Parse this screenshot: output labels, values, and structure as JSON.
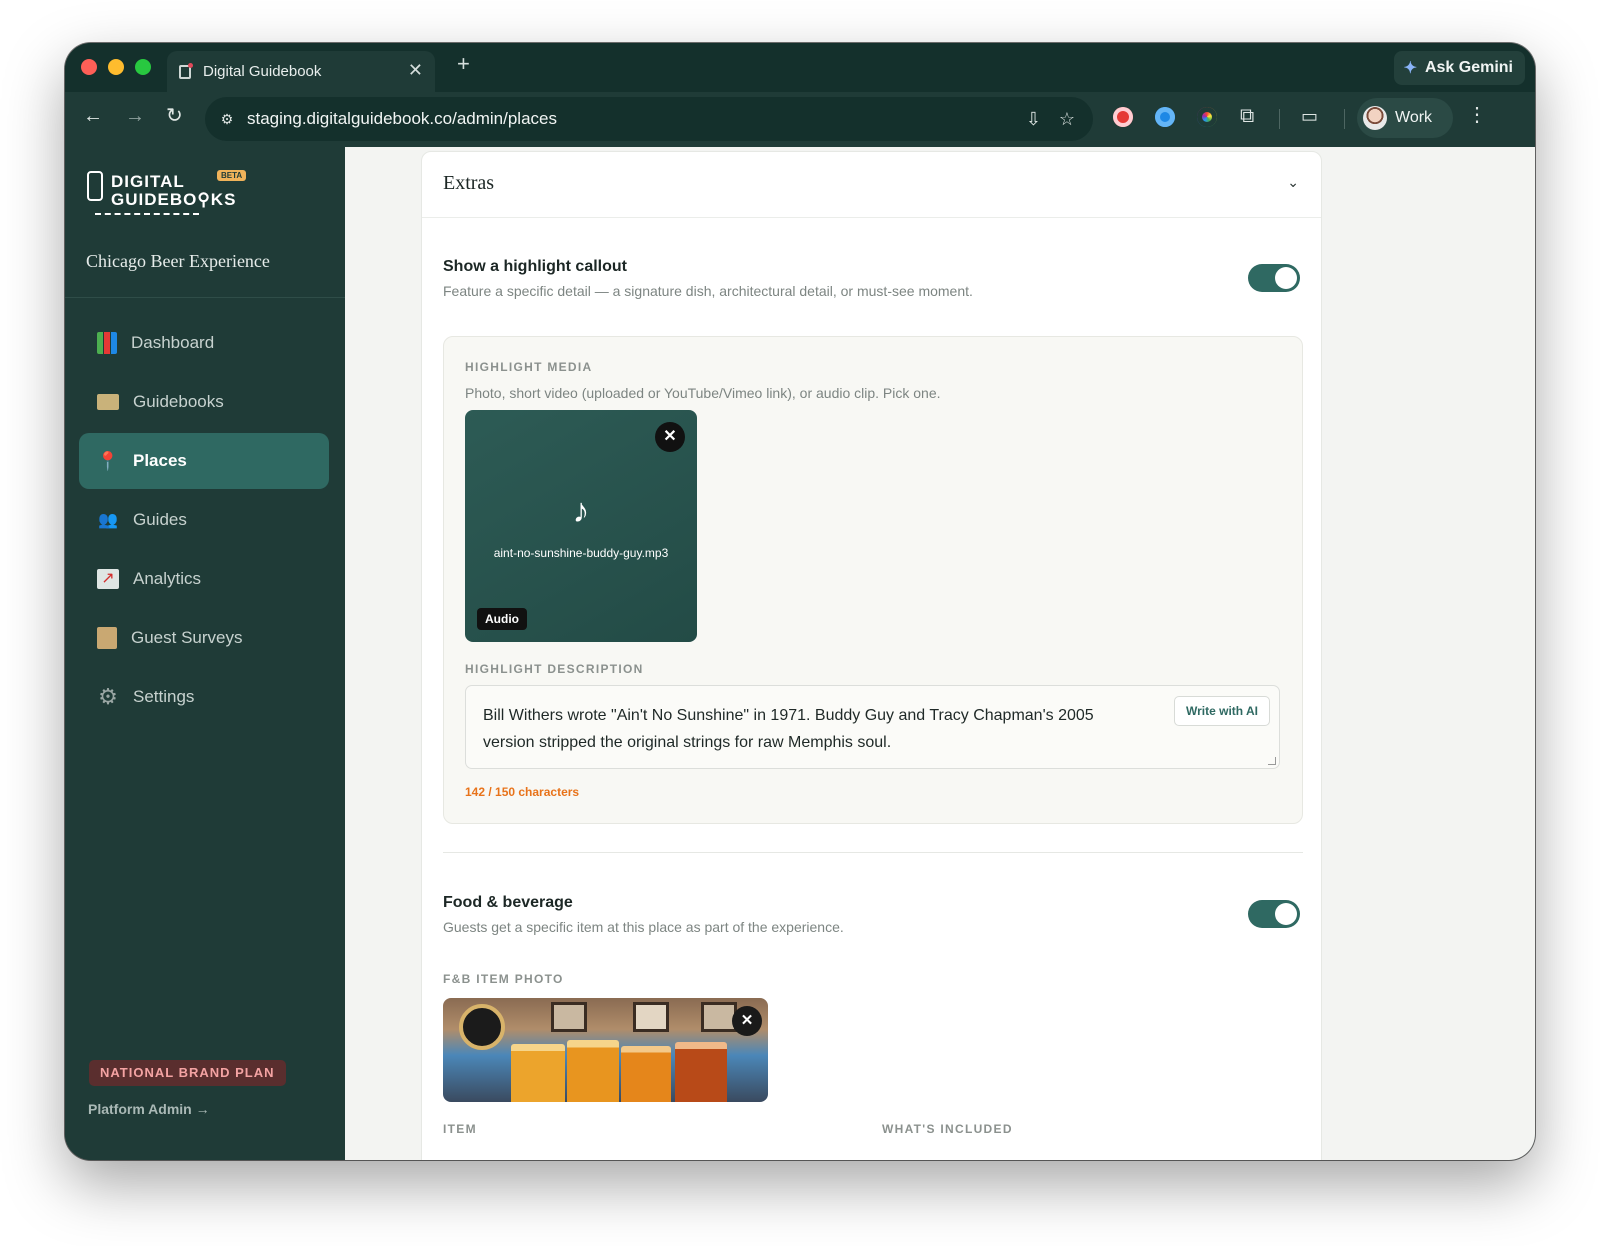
{
  "browser": {
    "tab_title": "Digital Guidebook",
    "new_tab": "+",
    "tab_close": "✕",
    "url": "staging.digitalguidebook.co/admin/places",
    "gemini_label": "Ask Gemini",
    "profile_label": "Work",
    "icons": [
      "back-icon",
      "forward-icon",
      "reload-icon",
      "site-info-icon",
      "install-icon",
      "star-icon",
      "record-extension-icon",
      "blue-extension-icon",
      "color-extension-icon",
      "extensions-icon",
      "split-view-icon",
      "menu-icon"
    ]
  },
  "sidebar": {
    "logo_line1": "DIGITAL",
    "logo_line2": "GUIDEBO⚲KS",
    "logo_badge": "BETA",
    "org_name": "Chicago Beer Experience",
    "items": [
      {
        "label": "Dashboard",
        "icon": "bar-chart-icon"
      },
      {
        "label": "Guidebooks",
        "icon": "book-icon"
      },
      {
        "label": "Places",
        "icon": "pin-icon",
        "active": true
      },
      {
        "label": "Guides",
        "icon": "people-icon"
      },
      {
        "label": "Analytics",
        "icon": "line-chart-icon"
      },
      {
        "label": "Guest Surveys",
        "icon": "clipboard-icon"
      },
      {
        "label": "Settings",
        "icon": "gear-icon"
      }
    ],
    "plan_badge": "NATIONAL BRAND PLAN",
    "platform_admin": "Platform Admin →"
  },
  "extras": {
    "title": "Extras",
    "highlight": {
      "title": "Show a highlight callout",
      "description": "Feature a specific detail — a signature dish, architectural detail, or must-see moment.",
      "enabled": true,
      "media_label": "HIGHLIGHT MEDIA",
      "media_help": "Photo, short video (uploaded or YouTube/Vimeo link), or audio clip. Pick one.",
      "media_glyph": "♪",
      "media_file": "aint-no-sunshine-buddy-guy.mp3",
      "media_type": "Audio",
      "remove_glyph": "✕",
      "description_label": "HIGHLIGHT DESCRIPTION",
      "description_value": "Bill Withers wrote \"Ain't No Sunshine\" in 1971. Buddy Guy and Tracy Chapman's 2005 version stripped the original strings for raw Memphis soul.",
      "ai_button": "Write with AI",
      "char_count": "142 / 150 characters"
    },
    "food_beverage": {
      "title": "Food & beverage",
      "description": "Guests get a specific item at this place as part of the experience.",
      "enabled": true,
      "photo_label": "F&B ITEM PHOTO",
      "remove_glyph": "✕",
      "item_label": "ITEM",
      "included_label": "WHAT'S INCLUDED"
    }
  },
  "colors": {
    "sidebar_bg": "#1f3b37",
    "accent": "#2f6962",
    "warning": "#e8731a",
    "plan_badge_bg": "#5a2e2e"
  }
}
